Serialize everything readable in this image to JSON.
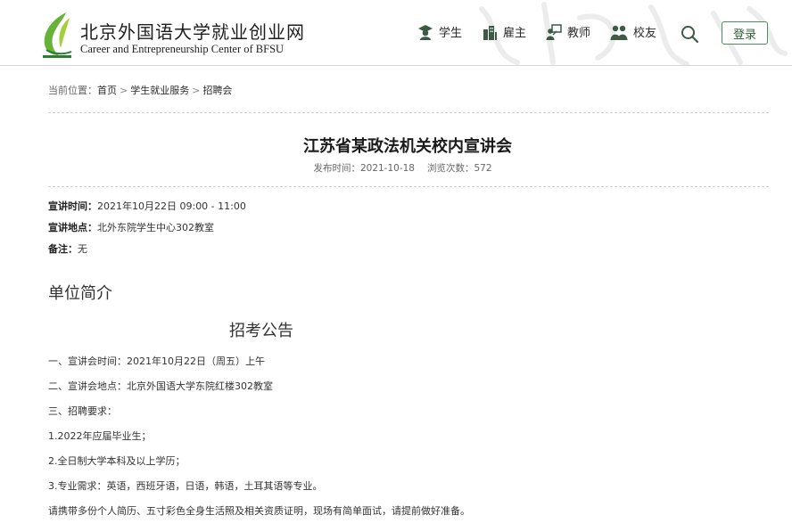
{
  "header": {
    "logo_cn": "北京外国语大学就业创业网",
    "logo_en": "Career and Entrepreneurship Center of BFSU",
    "nav": [
      {
        "label": "学生",
        "icon": "student-icon"
      },
      {
        "label": "雇主",
        "icon": "employer-building-icon"
      },
      {
        "label": "教师",
        "icon": "teacher-icon"
      },
      {
        "label": "校友",
        "icon": "alumni-group-icon"
      }
    ],
    "search_icon": "search-icon",
    "login_label": "登录",
    "colors": {
      "brand_green": "#4f8a5b",
      "nav_icon": "#3c5a45"
    }
  },
  "breadcrumb": {
    "prefix": "当前位置：",
    "items": [
      "首页",
      "学生就业服务",
      "招聘会"
    ],
    "separator": ">"
  },
  "article": {
    "title": "江苏省某政法机关校内宣讲会",
    "publish_label": "发布时间：",
    "publish_date": "2021-10-18",
    "views_label": "浏览次数：",
    "views": "572",
    "info": [
      {
        "label": "宣讲时间：",
        "value": "2021年10月22日 09:00 - 11:00"
      },
      {
        "label": "宣讲地点：",
        "value": "北外东院学生中心302教室"
      },
      {
        "label": "备注：",
        "value": "无"
      }
    ],
    "section_title": "单位简介",
    "notice_title": "招考公告",
    "paragraphs": [
      "一、宣讲会时间：2021年10月22日（周五）上午",
      "二、宣讲会地点：北京外国语大学东院红楼302教室",
      "三、招聘要求：",
      "1.2022年应届毕业生；",
      "2.全日制大学本科及以上学历；",
      "3.专业需求：英语，西班牙语，日语，韩语，土耳其语等专业。",
      "请携带多份个人简历、五寸彩色全身生活照及相关资质证明，现场有简单面试，请提前做好准备。"
    ]
  }
}
